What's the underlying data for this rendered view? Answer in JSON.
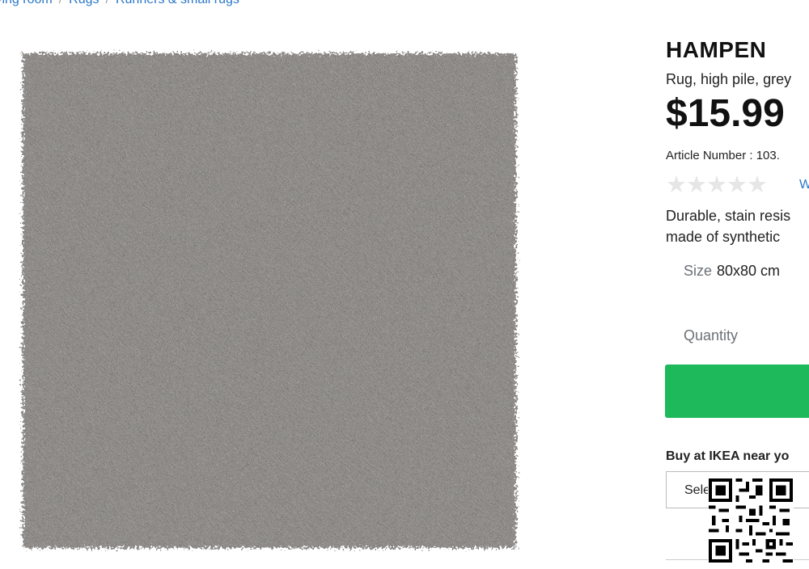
{
  "breadcrumb": {
    "items": [
      "Living room",
      "Rugs",
      "Runners & small rugs"
    ],
    "separator": "/"
  },
  "product": {
    "name": "HAMPEN",
    "subtitle": "Rug, high pile, grey",
    "price": "$15.99",
    "article_number": "Article Number : 103.",
    "rating_stars": "★★★★★",
    "rating_value": 0,
    "review_link": "W",
    "description_line1": "Durable, stain resis",
    "description_line2": "made of synthetic",
    "size_label": "Size",
    "size_value": "80x80 cm",
    "quantity_label": "Quantity"
  },
  "store": {
    "heading": "Buy at IKEA near yo",
    "select_label": "Select local"
  },
  "colors": {
    "accent_green": "#1db95a",
    "link_blue": "#2a77c9",
    "rug_grey": "#6e6a67"
  }
}
